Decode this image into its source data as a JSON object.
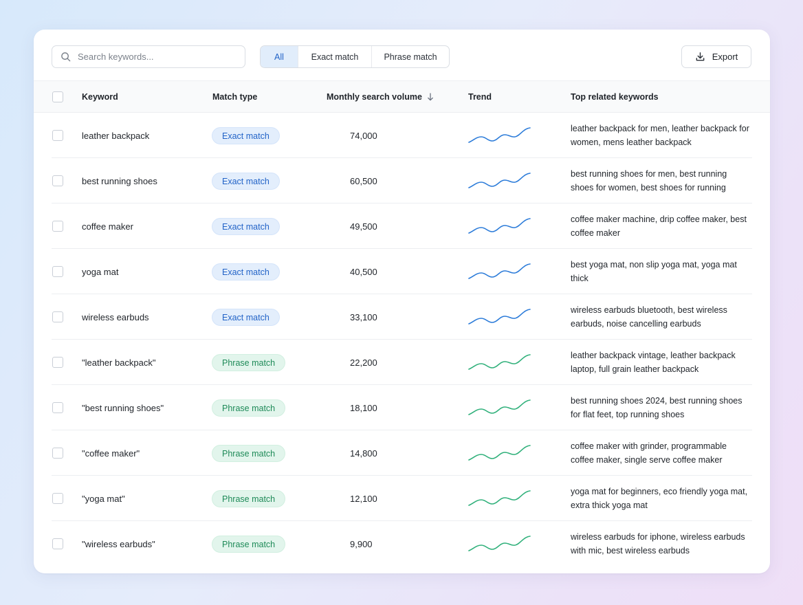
{
  "search": {
    "placeholder": "Search keywords..."
  },
  "filters": [
    "All",
    "Exact match",
    "Phrase match"
  ],
  "active_filter": "All",
  "export_label": "Export",
  "columns": {
    "keyword": "Keyword",
    "match_type": "Match type",
    "volume": "Monthly search volume",
    "trend": "Trend",
    "related": "Top related keywords"
  },
  "colors": {
    "exact": "#2b7bd9",
    "phrase": "#2fb07a",
    "accent": "#2263c7"
  },
  "rows": [
    {
      "keyword": "leather backpack",
      "match": "Exact match",
      "type": "exact",
      "volume": "74,000",
      "related": "leather backpack for men, leather backpack for women, mens leather backpack"
    },
    {
      "keyword": "best running shoes",
      "match": "Exact match",
      "type": "exact",
      "volume": "60,500",
      "related": "best running shoes for men, best running shoes for women, best shoes for running"
    },
    {
      "keyword": "coffee maker",
      "match": "Exact match",
      "type": "exact",
      "volume": "49,500",
      "related": "coffee maker machine, drip coffee maker, best coffee maker"
    },
    {
      "keyword": "yoga mat",
      "match": "Exact match",
      "type": "exact",
      "volume": "40,500",
      "related": "best yoga mat, non slip yoga mat, yoga mat thick"
    },
    {
      "keyword": "wireless earbuds",
      "match": "Exact match",
      "type": "exact",
      "volume": "33,100",
      "related": "wireless earbuds bluetooth, best wireless earbuds, noise cancelling earbuds"
    },
    {
      "keyword": "\"leather backpack\"",
      "match": "Phrase match",
      "type": "phrase",
      "volume": "22,200",
      "related": "leather backpack vintage, leather backpack laptop, full grain leather backpack"
    },
    {
      "keyword": "\"best running shoes\"",
      "match": "Phrase match",
      "type": "phrase",
      "volume": "18,100",
      "related": "best running shoes 2024, best running shoes for flat feet, top running shoes"
    },
    {
      "keyword": "\"coffee maker\"",
      "match": "Phrase match",
      "type": "phrase",
      "volume": "14,800",
      "related": "coffee maker with grinder, programmable coffee maker, single serve coffee maker"
    },
    {
      "keyword": "\"yoga mat\"",
      "match": "Phrase match",
      "type": "phrase",
      "volume": "12,100",
      "related": "yoga mat for beginners, eco friendly yoga mat, extra thick yoga mat"
    },
    {
      "keyword": "\"wireless earbuds\"",
      "match": "Phrase match",
      "type": "phrase",
      "volume": "9,900",
      "related": "wireless earbuds for iphone, wireless earbuds with mic, best wireless earbuds"
    }
  ]
}
